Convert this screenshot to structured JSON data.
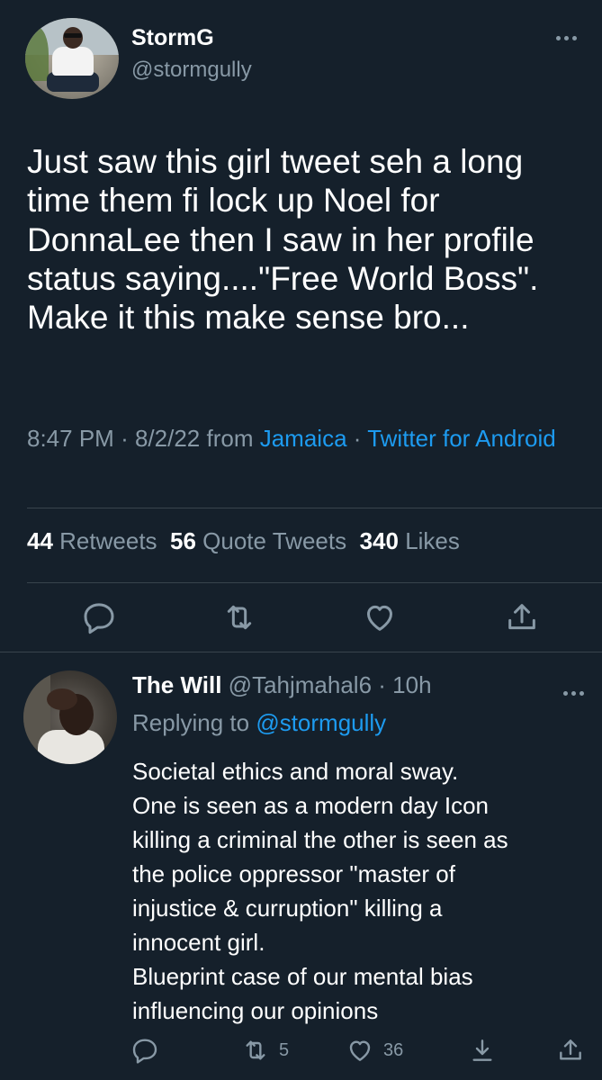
{
  "main_tweet": {
    "author_name": "StormG",
    "author_handle": "@stormgully",
    "text": "Just saw this girl tweet seh a long\ntime them fi lock up Noel for\nDonnaLee then I saw in her profile\nstatus saying....\"Free World Boss\".\nMake it this make sense bro...",
    "time": "8:47 PM",
    "date": "8/2/22",
    "from_label": "from",
    "location": "Jamaica",
    "source_app": "Twitter for Android",
    "stats": {
      "retweets_count": "44",
      "retweets_label": "Retweets",
      "quotes_count": "56",
      "quotes_label": "Quote Tweets",
      "likes_count": "340",
      "likes_label": "Likes"
    },
    "actions": [
      "reply-icon",
      "retweet-icon",
      "like-icon",
      "share-icon"
    ]
  },
  "reply": {
    "author_name": "The Will",
    "author_handle": "@Tahjmahal6",
    "time_ago": "10h",
    "replying_label": "Replying to",
    "replying_to": "@stormgully",
    "text": "Societal ethics and moral sway.\nOne is seen as a modern day Icon\nkilling a criminal the other is seen as\nthe police oppressor \"master of\ninjustice & curruption\" killing a\ninnocent girl.\nBlueprint case of our mental bias\ninfluencing our opinions",
    "retweets_count": "5",
    "likes_count": "36",
    "actions": [
      "reply-icon",
      "retweet-icon",
      "like-icon",
      "download-icon",
      "share-icon"
    ]
  },
  "colors": {
    "background": "#15202b",
    "text_primary": "#ffffff",
    "text_secondary": "#8899a6",
    "link": "#1d9bf0",
    "divider": "#38444d"
  }
}
